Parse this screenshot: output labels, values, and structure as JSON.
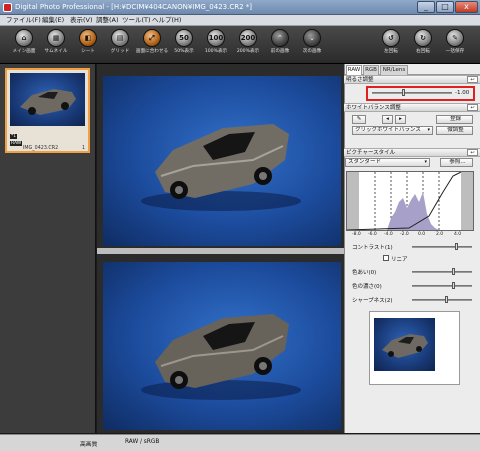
{
  "window": {
    "title": "Digital Photo Professional - [H:¥DCIM¥404CANON¥IMG_0423.CR2 *]",
    "minimize": "_",
    "maximize": "□",
    "close": "x"
  },
  "menu": [
    "ファイル(F)",
    "編集(E)",
    "表示(V)",
    "調整(A)",
    "ツール(T)",
    "ヘルプ(H)"
  ],
  "toolbar": {
    "items": [
      {
        "label": "メイン画面",
        "glyph": "⌂"
      },
      {
        "label": "サムネイル",
        "glyph": "▦"
      },
      {
        "label": "シート",
        "glyph": "◧"
      },
      {
        "label": "グリッド",
        "glyph": "▤"
      },
      {
        "label": "画面に合わせる",
        "glyph": "⤢"
      },
      {
        "label": "50%表示",
        "glyph": "50"
      },
      {
        "label": "100%表示",
        "glyph": "100"
      },
      {
        "label": "200%表示",
        "glyph": "200"
      },
      {
        "label": "前の画像",
        "glyph": "⌃"
      },
      {
        "label": "次の画像",
        "glyph": "⌄"
      },
      {
        "label": "左回転",
        "glyph": "↺"
      },
      {
        "label": "右回転",
        "glyph": "↻"
      },
      {
        "label": "一括保存",
        "glyph": "✎"
      }
    ]
  },
  "thumbnail": {
    "tag1": "*1",
    "tag2": "RAW",
    "filename": "IMG_0423.CR2",
    "number": "1"
  },
  "panel": {
    "tabs": [
      "RAW",
      "RGB",
      "NR/Lens"
    ],
    "brightness": {
      "title": "明るさ調整",
      "value": "-1.00",
      "reset": "↩",
      "slider_position": 0.4
    },
    "wb": {
      "title": "ホワイトバランス調整",
      "reset": "↩",
      "register": "登録",
      "select": "クリックホワイトバランス",
      "fine": "微調整"
    },
    "picture_style": {
      "title": "ピクチャースタイル",
      "reset": "↩",
      "select": "スタンダード",
      "browse": "参照..."
    },
    "histogram_axis": [
      "-8.0",
      "-6.0",
      "-4.0",
      "-2.0",
      "0.0",
      "2.0",
      "4.0"
    ],
    "contrast": {
      "label": "コントラスト(1)"
    },
    "linear": {
      "label": "リニア"
    },
    "color_tone": {
      "label": "色あい(0)"
    },
    "color_saturation": {
      "label": "色の濃さ(0)"
    },
    "sharpness": {
      "label": "シャープネス(2)"
    }
  },
  "status": {
    "quality": "高画質",
    "colorspace": "RAW / sRGB"
  }
}
